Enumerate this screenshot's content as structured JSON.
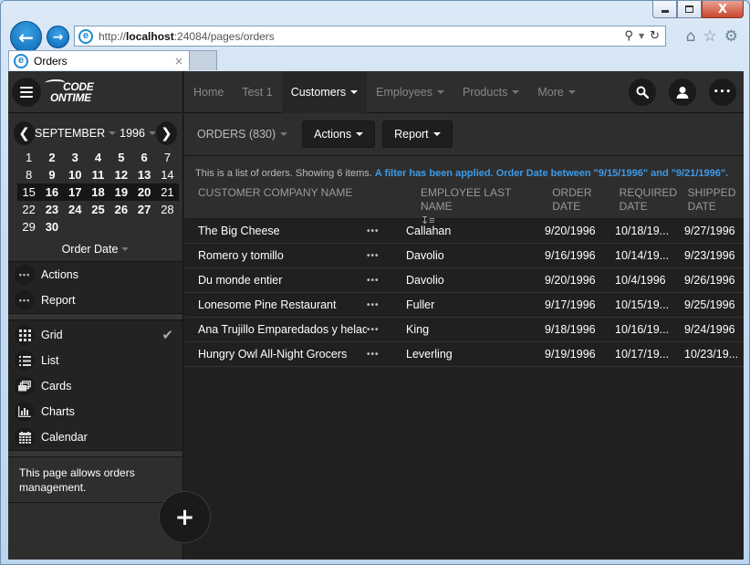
{
  "browser": {
    "url_prefix": "http://",
    "url_host": "localhost",
    "url_rest": ":24084/pages/orders",
    "tab_title": "Orders",
    "tab_close": "×",
    "win_close": "X"
  },
  "sidebar": {
    "logo_line1": "CODE",
    "logo_line2": "ONTIME",
    "calendar": {
      "month": "SEPTEMBER",
      "year": "1996",
      "weeks": [
        [
          {
            "d": "1",
            "b": false
          },
          {
            "d": "2",
            "b": true
          },
          {
            "d": "3",
            "b": true
          },
          {
            "d": "4",
            "b": true
          },
          {
            "d": "5",
            "b": true
          },
          {
            "d": "6",
            "b": true
          },
          {
            "d": "7",
            "b": false
          }
        ],
        [
          {
            "d": "8",
            "b": false
          },
          {
            "d": "9",
            "b": true
          },
          {
            "d": "10",
            "b": true
          },
          {
            "d": "11",
            "b": true
          },
          {
            "d": "12",
            "b": true
          },
          {
            "d": "13",
            "b": true
          },
          {
            "d": "14",
            "b": false
          }
        ],
        [
          {
            "d": "15",
            "b": false
          },
          {
            "d": "16",
            "b": true
          },
          {
            "d": "17",
            "b": true
          },
          {
            "d": "18",
            "b": true
          },
          {
            "d": "19",
            "b": true
          },
          {
            "d": "20",
            "b": true
          },
          {
            "d": "21",
            "b": false
          }
        ],
        [
          {
            "d": "22",
            "b": false
          },
          {
            "d": "23",
            "b": true
          },
          {
            "d": "24",
            "b": true
          },
          {
            "d": "25",
            "b": true
          },
          {
            "d": "26",
            "b": true
          },
          {
            "d": "27",
            "b": true
          },
          {
            "d": "28",
            "b": false
          }
        ],
        [
          {
            "d": "29",
            "b": false
          },
          {
            "d": "30",
            "b": true
          }
        ]
      ],
      "selected_week": 2,
      "field": "Order Date"
    },
    "actions": [
      {
        "label": "Actions",
        "icon": "ellipsis-icon"
      },
      {
        "label": "Report",
        "icon": "ellipsis-icon"
      }
    ],
    "views": [
      {
        "label": "Grid",
        "icon": "grid-icon",
        "selected": true
      },
      {
        "label": "List",
        "icon": "list-icon",
        "selected": false
      },
      {
        "label": "Cards",
        "icon": "cards-icon",
        "selected": false
      },
      {
        "label": "Charts",
        "icon": "charts-icon",
        "selected": false
      },
      {
        "label": "Calendar",
        "icon": "calendar-icon",
        "selected": false
      }
    ],
    "description": "This page allows orders management."
  },
  "topnav": {
    "items": [
      {
        "label": "Home",
        "dropdown": false,
        "active": false
      },
      {
        "label": "Test 1",
        "dropdown": false,
        "active": false
      },
      {
        "label": "Customers",
        "dropdown": true,
        "active": true
      },
      {
        "label": "Employees",
        "dropdown": true,
        "active": false
      },
      {
        "label": "Products",
        "dropdown": true,
        "active": false
      },
      {
        "label": "More",
        "dropdown": true,
        "active": false
      }
    ]
  },
  "toolbar": {
    "view_label": "ORDERS (830)",
    "actions_label": "Actions",
    "report_label": "Report"
  },
  "info": {
    "text": "This is a list of orders. Showing 6 items. ",
    "filter": "A filter has been applied. Order Date between \"9/15/1996\" and \"9/21/1996\"."
  },
  "grid": {
    "columns": [
      {
        "label": "CUSTOMER COMPANY NAME"
      },
      {
        "label": "EMPLOYEE LAST NAME",
        "sort": "sort-ascending-icon"
      },
      {
        "label": "ORDER DATE",
        "filter": "filter-icon"
      },
      {
        "label": "REQUIRED DATE"
      },
      {
        "label": "SHIPPED DATE",
        "sort": "sort-ascending-icon"
      }
    ],
    "rows": [
      {
        "customer": "The Big Cheese",
        "employee": "Callahan",
        "order_date": "9/20/1996",
        "required_date": "10/18/19...",
        "shipped_date": "9/27/1996"
      },
      {
        "customer": "Romero y tomillo",
        "employee": "Davolio",
        "order_date": "9/16/1996",
        "required_date": "10/14/19...",
        "shipped_date": "9/23/1996"
      },
      {
        "customer": "Du monde entier",
        "employee": "Davolio",
        "order_date": "9/20/1996",
        "required_date": "10/4/1996",
        "shipped_date": "9/26/1996"
      },
      {
        "customer": "Lonesome Pine Restaurant",
        "employee": "Fuller",
        "order_date": "9/17/1996",
        "required_date": "10/15/19...",
        "shipped_date": "9/25/1996"
      },
      {
        "customer": "Ana Trujillo Emparedados y helados",
        "employee": "King",
        "order_date": "9/18/1996",
        "required_date": "10/16/19...",
        "shipped_date": "9/24/1996"
      },
      {
        "customer": "Hungry Owl All-Night Grocers",
        "employee": "Leverling",
        "order_date": "9/19/1996",
        "required_date": "10/17/19...",
        "shipped_date": "10/23/19..."
      }
    ],
    "row_menu": "•••"
  },
  "colors": {
    "accent": "#3d9ae8",
    "background": "#202020",
    "panel": "#2e2e2e"
  }
}
